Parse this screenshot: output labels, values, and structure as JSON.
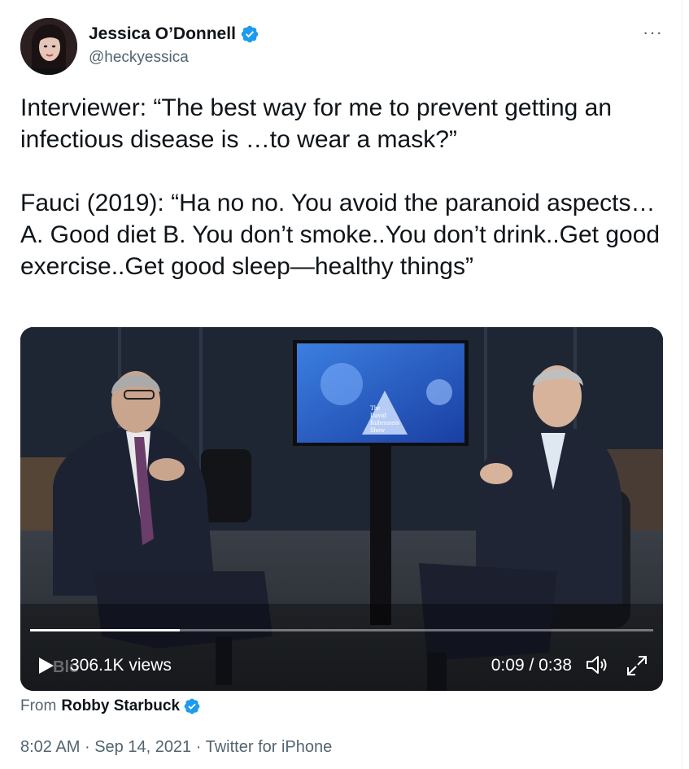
{
  "author": {
    "name": "Jessica O’Donnell",
    "handle": "@heckyessica",
    "verified": true
  },
  "more_label": "···",
  "tweet": {
    "text": "Interviewer: “The best way for me to prevent getting an infectious disease is …to wear a mask?”\n\nFauci (2019): “Ha no no.  You avoid the paranoid aspects…A. Good diet B. You don’t smoke..You don’t drink..Get good exercise..Get good sleep—healthy things”"
  },
  "video": {
    "views": "306.1K views",
    "time": "0:09 / 0:38",
    "progress": 0.24,
    "screen_title": "The David Rubenstein Show",
    "watermark": "Blo"
  },
  "source": {
    "from_label": "From",
    "from_name": "Robby Starbuck",
    "from_verified": true
  },
  "meta": {
    "time": "8:02 AM",
    "separator": "·",
    "date": "Sep 14, 2021",
    "client": "Twitter for iPhone"
  },
  "colors": {
    "verified_blue": "#1d9bf0",
    "secondary_text": "#536471",
    "primary_text": "#0f1419"
  }
}
